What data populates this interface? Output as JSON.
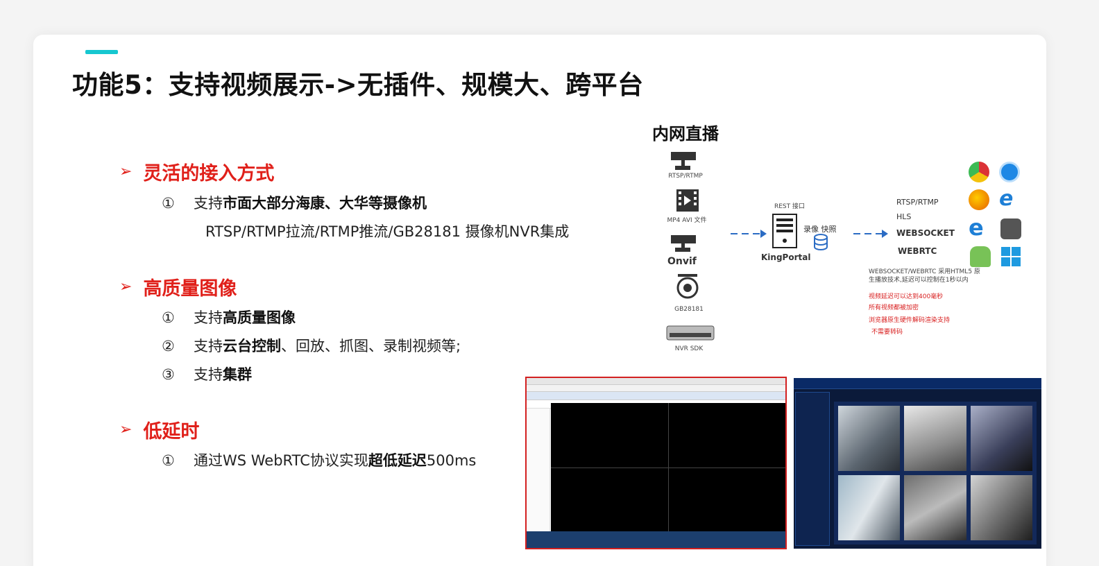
{
  "title": "功能5：支持视频展示->无插件、规模大、跨平台",
  "sections": [
    {
      "heading": "灵活的接入方式",
      "items": [
        {
          "num": "①",
          "prefix": "支持",
          "bold": "市面大部分海康、大华等摄像机",
          "suffix": ""
        }
      ],
      "subline": "RTSP/RTMP拉流/RTMP推流/GB28181 摄像机NVR集成"
    },
    {
      "heading": "高质量图像",
      "items": [
        {
          "num": "①",
          "prefix": "支持",
          "bold": "高质量图像",
          "suffix": ""
        },
        {
          "num": "②",
          "prefix": "支持",
          "bold": "云台控制",
          "suffix": "、回放、抓图、录制视频等;"
        },
        {
          "num": "③",
          "prefix": "支持",
          "bold": "集群",
          "suffix": ""
        }
      ]
    },
    {
      "heading": "低延时",
      "items": [
        {
          "num": "①",
          "prefix": "通过WS WebRTC协议实现",
          "bold": "超低延迟",
          "suffix": "500ms"
        }
      ]
    }
  ],
  "diagram": {
    "title": "内网直播",
    "sources": [
      "RTSP/RTMP",
      "MP4 AVI 文件",
      "Onvif",
      "GB28181",
      "NVR SDK"
    ],
    "rest_label": "REST 接口",
    "server_label": "KingPortal",
    "record_label": "录像 快照",
    "protocols": [
      "RTSP/RTMP",
      "HLS",
      "WEBSOCKET",
      "WEBRTC"
    ],
    "note_lines": [
      "WEBSOCKET/WEBRTC 采用HTML5 原",
      "生播放技术,延迟可以控制在1秒以内"
    ],
    "red_notes": [
      "视频延迟可以达到400毫秒",
      "所有视频都被加密",
      "浏览器原生硬件解码渲染支持",
      "不需要转码"
    ],
    "colors": {
      "accent": "#16c7d0",
      "red": "#e0201a",
      "arrow": "#2b6cc4"
    }
  }
}
